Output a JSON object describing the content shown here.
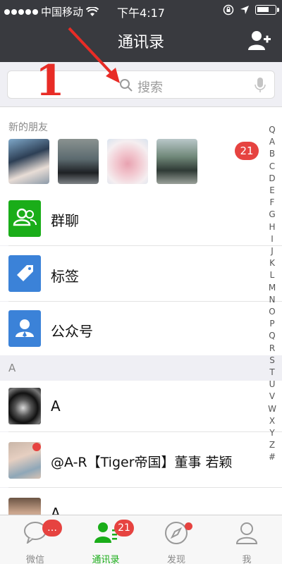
{
  "status": {
    "carrier": "中国移动",
    "time": "下午4:17"
  },
  "nav": {
    "title": "通讯录"
  },
  "search": {
    "placeholder": "搜索"
  },
  "annotation": {
    "number": "1"
  },
  "new_friends": {
    "title": "新的朋友",
    "badge": "21"
  },
  "contact_entries": [
    {
      "label": "群聊",
      "icon": "group-chat-icon",
      "color": "#1aad19"
    },
    {
      "label": "标签",
      "icon": "tag-icon",
      "color": "#3b82d8"
    },
    {
      "label": "公众号",
      "icon": "official-account-icon",
      "color": "#3b82d8"
    }
  ],
  "section_letter": "A",
  "contacts": [
    {
      "name": "A"
    },
    {
      "name": "@A-R【Tiger帝国】董事 若颖"
    },
    {
      "name": "A"
    }
  ],
  "index_letters": [
    "Q",
    "A",
    "B",
    "C",
    "D",
    "E",
    "F",
    "G",
    "H",
    "I",
    "J",
    "K",
    "L",
    "M",
    "N",
    "O",
    "P",
    "Q",
    "R",
    "S",
    "T",
    "U",
    "V",
    "W",
    "X",
    "Y",
    "Z",
    "#"
  ],
  "tabs": [
    {
      "label": "微信",
      "badge": "…"
    },
    {
      "label": "通讯录",
      "badge": "21"
    },
    {
      "label": "发现"
    },
    {
      "label": "我"
    }
  ],
  "colors": {
    "accent": "#1aad19",
    "badge": "#e64340",
    "navbar": "#393a3f",
    "annotation": "#e82c26"
  }
}
